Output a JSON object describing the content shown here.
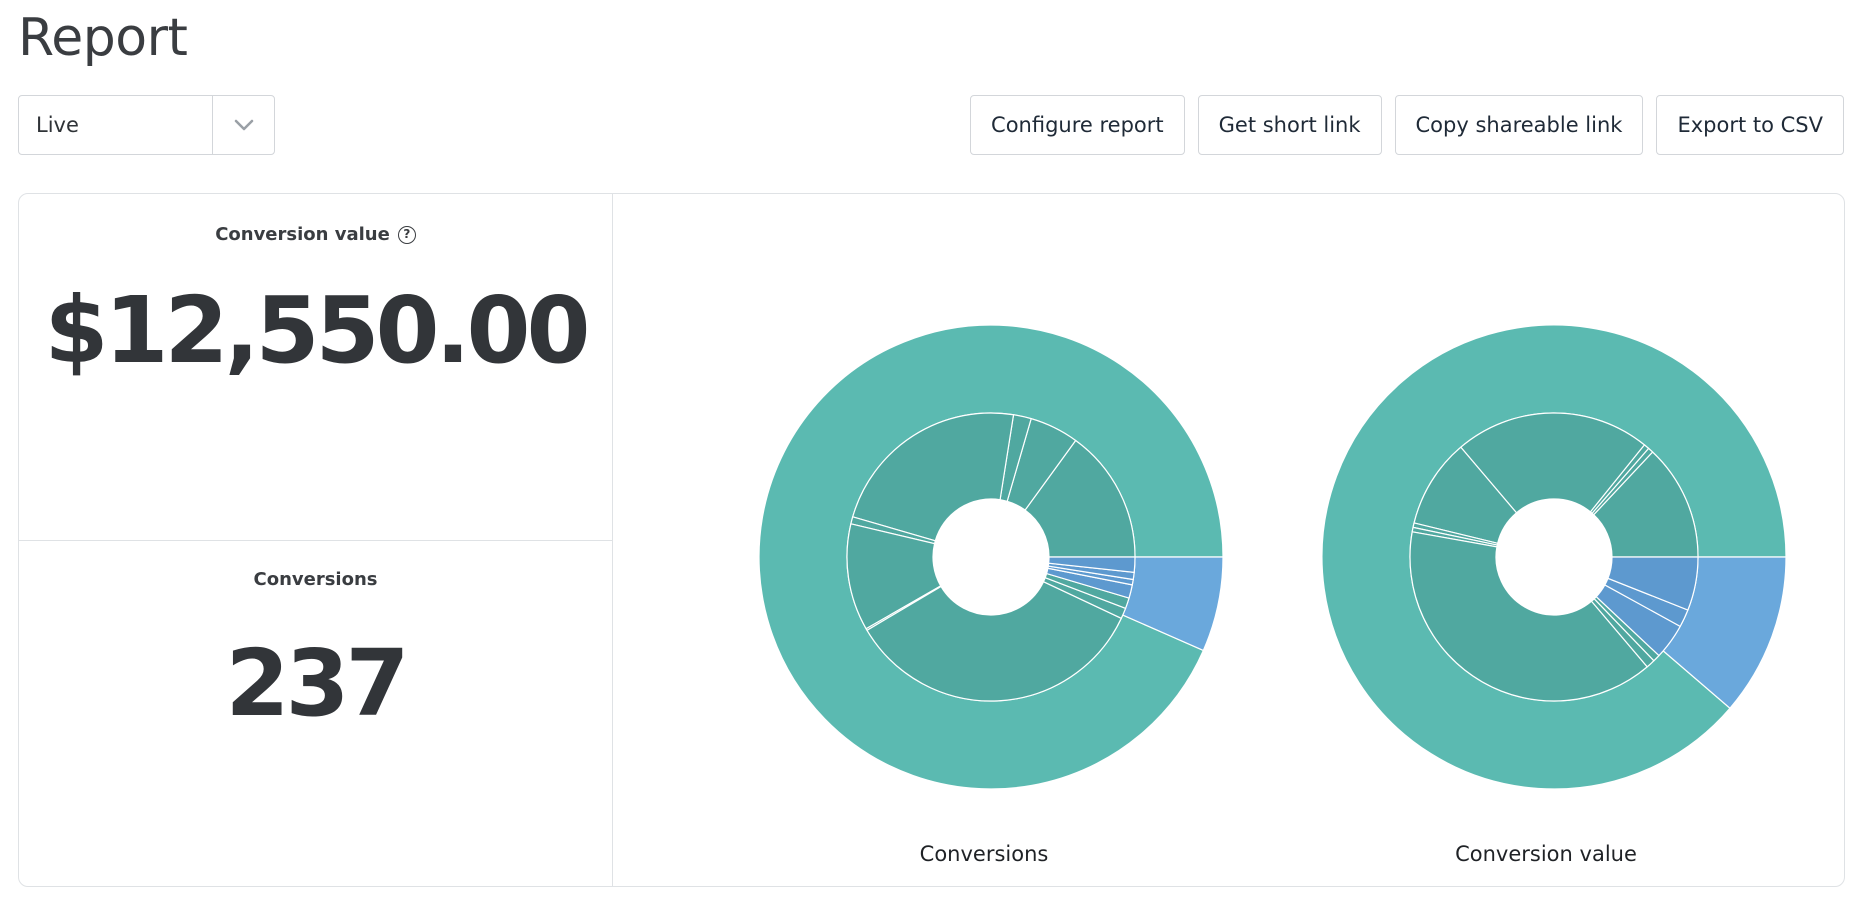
{
  "header": {
    "title": "Report"
  },
  "range": {
    "value": "Live"
  },
  "toolbar": {
    "configure": "Configure report",
    "short_link": "Get short link",
    "copy_link": "Copy shareable link",
    "export": "Export to CSV"
  },
  "metrics": {
    "conversion_value": {
      "label": "Conversion value",
      "value": "$12,550.00"
    },
    "conversions": {
      "label": "Conversions",
      "value": "237"
    }
  },
  "colors": {
    "outer_main": "#5bbab1",
    "inner_main": "#50a8a0",
    "outer_accent": "#6aa8dc",
    "inner_accent": "#5d99cf",
    "border": "#dfe2e5"
  },
  "chart_data": [
    {
      "type": "sunburst",
      "caption": "Conversions",
      "outer": [
        {
          "value": 0.934,
          "color": "#5bbab1"
        },
        {
          "value": 0.066,
          "color": "#6aa8dc"
        }
      ],
      "inner": [
        {
          "value": 0.15,
          "color": "#50a8a0"
        },
        {
          "value": 0.055,
          "color": "#50a8a0"
        },
        {
          "value": 0.02,
          "color": "#50a8a0"
        },
        {
          "value": 0.23,
          "color": "#50a8a0"
        },
        {
          "value": 0.008,
          "color": "#50a8a0"
        },
        {
          "value": 0.12,
          "color": "#50a8a0"
        },
        {
          "value": 0.002,
          "color": "#50a8a0"
        },
        {
          "value": 0.345,
          "color": "#50a8a0"
        },
        {
          "value": 0.012,
          "color": "#50a8a0"
        },
        {
          "value": 0.012,
          "color": "#50a8a0"
        },
        {
          "value": 0.015,
          "color": "#5d99cf"
        },
        {
          "value": 0.006,
          "color": "#5d99cf"
        },
        {
          "value": 0.008,
          "color": "#5d99cf"
        },
        {
          "value": 0.017,
          "color": "#5d99cf"
        }
      ]
    },
    {
      "type": "sunburst",
      "caption": "Conversion value",
      "outer": [
        {
          "value": 0.887,
          "color": "#5bbab1"
        },
        {
          "value": 0.113,
          "color": "#6aa8dc"
        }
      ],
      "inner": [
        {
          "value": 0.13,
          "color": "#50a8a0"
        },
        {
          "value": 0.006,
          "color": "#50a8a0"
        },
        {
          "value": 0.006,
          "color": "#50a8a0"
        },
        {
          "value": 0.22,
          "color": "#50a8a0"
        },
        {
          "value": 0.1,
          "color": "#50a8a0"
        },
        {
          "value": 0.005,
          "color": "#50a8a0"
        },
        {
          "value": 0.005,
          "color": "#50a8a0"
        },
        {
          "value": 0.39,
          "color": "#50a8a0"
        },
        {
          "value": 0.01,
          "color": "#50a8a0"
        },
        {
          "value": 0.008,
          "color": "#50a8a0"
        },
        {
          "value": 0.04,
          "color": "#5d99cf"
        },
        {
          "value": 0.02,
          "color": "#5d99cf"
        },
        {
          "value": 0.06,
          "color": "#5d99cf"
        }
      ]
    }
  ]
}
